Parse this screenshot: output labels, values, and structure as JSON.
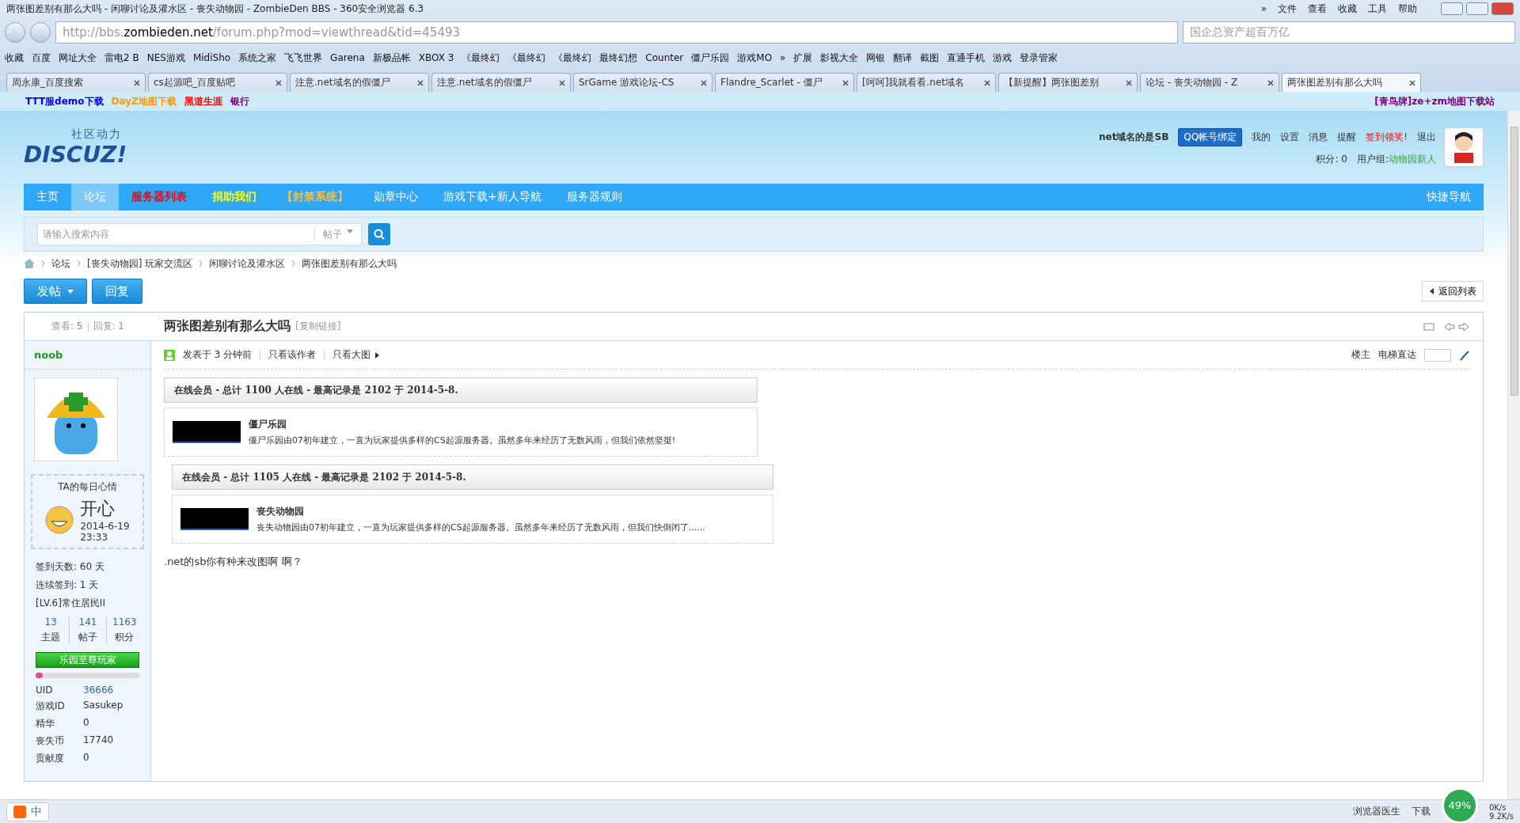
{
  "window": {
    "title": "两张图差别有那么大吗 - 闲聊讨论及灌水区 - 丧失动物园 - ZombieDen BBS - 360安全浏览器 6.3",
    "menu": [
      "»",
      "文件",
      "查看",
      "收藏",
      "工具",
      "帮助"
    ]
  },
  "address_bar": {
    "prefix": "http://bbs.",
    "domain": "zombieden.net",
    "path": "/forum.php?mod=viewthread&tid=45493"
  },
  "search_box": {
    "placeholder": "国企总资产超百万亿"
  },
  "bookmarks": [
    "收藏",
    "百度",
    "网址大全",
    "雷电2 B",
    "NES游戏",
    "MidiSho",
    "系统之家",
    "飞飞世界",
    "Garena",
    "新极品帐",
    "XBOX 3",
    "《最终幻",
    "《最终幻",
    "《最终幻",
    "最终幻想",
    "Counter",
    "僵尸乐园",
    "游戏MO",
    "»",
    "扩展",
    "影视大全",
    "网银",
    "翻译",
    "截图",
    "直通手机",
    "游戏",
    "登录管家"
  ],
  "tabs": [
    {
      "label": "周永康_百度搜索",
      "selected": false
    },
    {
      "label": "cs起源吧_百度贴吧",
      "selected": false
    },
    {
      "label": "注意.net域名的假僵尸",
      "selected": false
    },
    {
      "label": "注意.net域名的假僵尸",
      "selected": false
    },
    {
      "label": "SrGame 游戏论坛-CS",
      "selected": false
    },
    {
      "label": "Flandre_Scarlet - 僵尸",
      "selected": false
    },
    {
      "label": "[呵呵]我就看看.net域名",
      "selected": false
    },
    {
      "label": "【新提醒】两张图差别",
      "selected": false
    },
    {
      "label": "论坛 - 丧失动物园 - Z",
      "selected": false
    },
    {
      "label": "两张图差别有那么大吗",
      "selected": true
    }
  ],
  "notice_bar": {
    "links": [
      {
        "label": "TTT服demo下载",
        "kind": "blue"
      },
      {
        "label": "DayZ地图下载",
        "kind": "orange"
      },
      {
        "label": "黑道生涯",
        "kind": "red"
      },
      {
        "label": "银行",
        "kind": "purple"
      }
    ],
    "right_link": "[青鸟牌]ze+zm地图下载站"
  },
  "site_header": {
    "logo_text": "社区动力",
    "logo_word": "DISCUZ!",
    "user": {
      "name": "net域名的是SB",
      "qq_button": "QQ帐号绑定",
      "links": [
        "我的",
        "设置",
        "消息",
        "提醒"
      ],
      "signin": "签到领奖!",
      "logout": "退出",
      "points": "积分: 0",
      "group_label": "用户组: ",
      "group": "动物园新人"
    }
  },
  "nav": {
    "items": [
      {
        "label": "主页",
        "kind": "plain",
        "selected": false
      },
      {
        "label": "论坛",
        "kind": "plain",
        "selected": true
      },
      {
        "label": "服务器列表",
        "kind": "red",
        "selected": false
      },
      {
        "label": "捐助我们",
        "kind": "yellow",
        "selected": false
      },
      {
        "label": "【封禁系统】",
        "kind": "orange",
        "selected": false
      },
      {
        "label": "勋章中心",
        "kind": "plain",
        "selected": false
      },
      {
        "label": "游戏下载+新人导航",
        "kind": "plain",
        "selected": false
      },
      {
        "label": "服务器规则",
        "kind": "plain",
        "selected": false
      }
    ],
    "right": "快捷导航"
  },
  "forum_search": {
    "placeholder": "请输入搜索内容",
    "scope": "帖子"
  },
  "breadcrumb": [
    "论坛",
    "[丧失动物园] 玩家交流区",
    "闲聊讨论及灌水区",
    "两张图差别有那么大吗"
  ],
  "actions": {
    "post": "发帖",
    "reply": "回复",
    "back": "返回列表"
  },
  "thread": {
    "views_label": "查看: ",
    "views": "5",
    "replies_label": "回复: ",
    "replies": "1",
    "title": "两张图差别有那么大吗",
    "copy_link": "[复制链接]"
  },
  "author": {
    "name": "noob",
    "mood_title": "TA的每日心情",
    "mood": "开心",
    "mood_date": "2014-6-19",
    "mood_time": "23:33",
    "stats_lines": [
      "签到天数: 60 天",
      "连续签到: 1 天",
      "[LV.6]常住居民II"
    ],
    "counts": [
      {
        "value": "13",
        "label": "主题"
      },
      {
        "value": "141",
        "label": "帖子"
      },
      {
        "value": "1163",
        "label": "积分"
      }
    ],
    "medal": "乐园至尊玩家",
    "level": 0.07,
    "profile": [
      {
        "key": "UID",
        "value": "36666",
        "link": true
      },
      {
        "key": "游戏ID",
        "value": "Sasukep",
        "link": false
      },
      {
        "key": "精华",
        "value": "0",
        "link": false
      },
      {
        "key": "丧失币",
        "value": "17740",
        "link": false
      },
      {
        "key": "贡献度",
        "value": "0",
        "link": false
      }
    ]
  },
  "post": {
    "posted": "发表于 3 分钟前",
    "only_author": "只看该作者",
    "only_big": "只看大图",
    "floor": "楼主",
    "jump_label": "电梯直达",
    "quotes": [
      {
        "header": "在线会员 - 总计 1100 人在线 - 最高记录是 2102 于 2014-5-8.",
        "name": "僵尸乐园",
        "desc": "僵尸乐园由07初年建立，一直为玩家提供多样的CS起源服务器。虽然多年来经历了无数风雨，但我们依然坚挺!"
      },
      {
        "header": "在线会员 - 总计 1105 人在线 - 最高记录是 2102 于 2014-5-8.",
        "name": "丧失动物园",
        "desc": "丧失动物园由07初年建立，一直为玩家提供多样的CS起源服务器。虽然多年来经历了无数风雨，但我们快倒闭了......"
      }
    ],
    "body": ".net的sb你有种来改图啊 啊？"
  },
  "status_bar": {
    "doctor": "浏览器医生",
    "download": "下载",
    "percent": "49%",
    "up": "0K/s",
    "down": "9.2K/s",
    "ime": "中"
  }
}
